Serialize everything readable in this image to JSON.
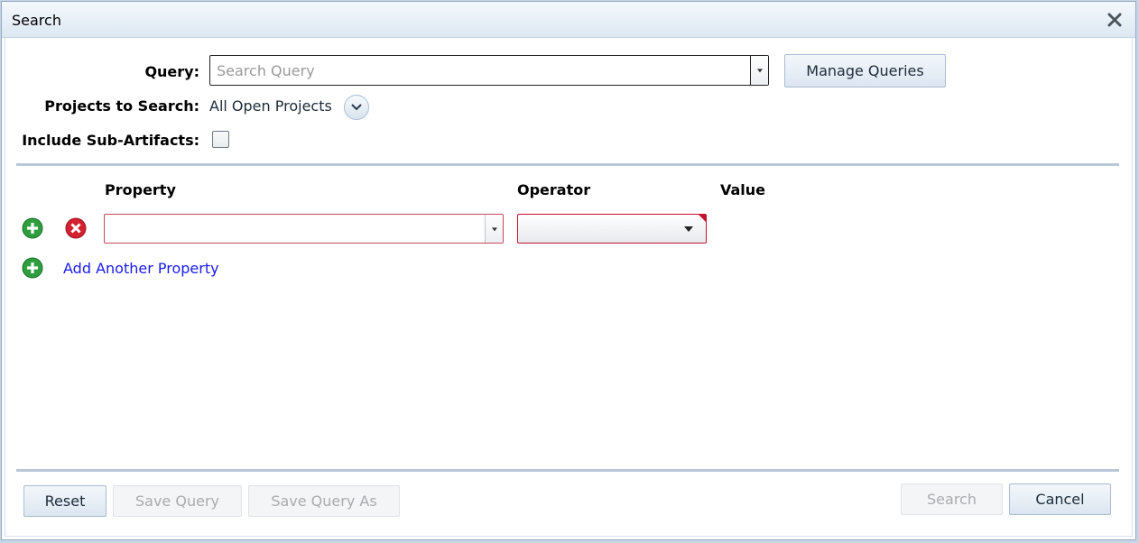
{
  "window": {
    "title": "Search"
  },
  "query": {
    "label": "Query:",
    "placeholder": "Search Query",
    "value": "",
    "manage_label": "Manage Queries"
  },
  "projects": {
    "label": "Projects to Search:",
    "value": "All Open Projects"
  },
  "sub_artifacts": {
    "label": "Include Sub-Artifacts:",
    "checked": false
  },
  "columns": {
    "property": "Property",
    "operator": "Operator",
    "value": "Value"
  },
  "criteria_row": {
    "property_value": "",
    "operator_value": ""
  },
  "add_property_label": "Add Another Property",
  "footer": {
    "reset": "Reset",
    "save_query": "Save Query",
    "save_query_as": "Save Query As",
    "search": "Search",
    "cancel": "Cancel"
  },
  "icons": {
    "close": "close-icon",
    "add": "plus-circle-icon",
    "remove": "x-circle-icon",
    "dropdown": "chevron-down-icon"
  },
  "colors": {
    "accent_green": "#2e9e3e",
    "error_red": "#c8102e",
    "link_blue": "#1a1aee",
    "title_bar": "#dde8f3"
  }
}
